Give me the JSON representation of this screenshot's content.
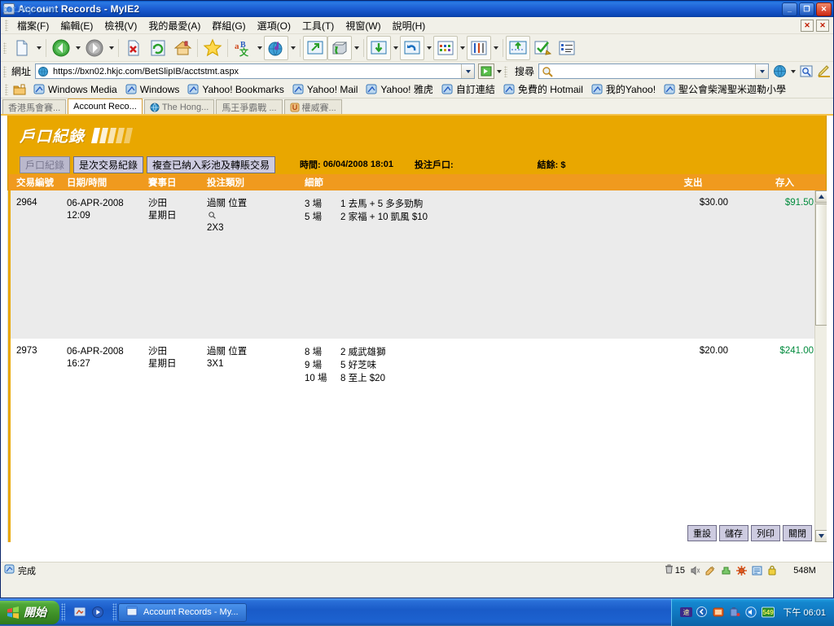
{
  "window": {
    "title": "Account Records - MyIE2",
    "watermark": "bet.hkjc.com",
    "minimize_label": "_",
    "maximize_label": "❐",
    "close_label": "✕"
  },
  "menubar": {
    "items": [
      {
        "label": "檔案(F)",
        "name": "menu-file"
      },
      {
        "label": "編輯(E)",
        "name": "menu-edit"
      },
      {
        "label": "檢視(V)",
        "name": "menu-view"
      },
      {
        "label": "我的最愛(A)",
        "name": "menu-favorites"
      },
      {
        "label": "群組(G)",
        "name": "menu-group"
      },
      {
        "label": "選項(O)",
        "name": "menu-options"
      },
      {
        "label": "工具(T)",
        "name": "menu-tools"
      },
      {
        "label": "視窗(W)",
        "name": "menu-window"
      },
      {
        "label": "說明(H)",
        "name": "menu-help"
      }
    ],
    "doc_close_label": "✕",
    "app_close_label": "✕"
  },
  "toolbar": {
    "icons": [
      "new-page-icon",
      "back-icon",
      "forward-icon",
      "stop-icon",
      "refresh-icon",
      "home-icon",
      "favorites-star-icon",
      "translate-icon",
      "globe-media-icon",
      "open-external-icon",
      "download-manager-icon",
      "save-page-icon",
      "undo-close-icon",
      "grid-view-icon",
      "tools-icon",
      "upload-icon",
      "check-page-icon",
      "list-view-icon"
    ]
  },
  "address": {
    "label": "網址",
    "url": "https://bxn02.hkjc.com/BetSlipIB/acctstmt.aspx",
    "go_label": "▶",
    "search_label": "搜尋",
    "search_value": "",
    "search_placeholder": ""
  },
  "links": {
    "items": [
      {
        "label": "Windows Media"
      },
      {
        "label": "Windows"
      },
      {
        "label": "Yahoo! Bookmarks"
      },
      {
        "label": "Yahoo! Mail"
      },
      {
        "label": "Yahoo! 雅虎"
      },
      {
        "label": "自訂連結"
      },
      {
        "label": "免費的 Hotmail"
      },
      {
        "label": "我的Yahoo!"
      },
      {
        "label": "聖公會柴灣聖米迦勒小學"
      }
    ]
  },
  "tabs": [
    {
      "label": "香港馬會賽...",
      "active": false,
      "icon": false
    },
    {
      "label": "Account Reco...",
      "active": true,
      "icon": false
    },
    {
      "label": "The Hong...",
      "active": false,
      "icon": true
    },
    {
      "label": "馬王爭霸戰 ...",
      "active": false,
      "icon": false
    },
    {
      "label": "權威賽...",
      "active": false,
      "icon": true
    }
  ],
  "banner": {
    "title": "戶口紀錄"
  },
  "subbar": {
    "pills": [
      {
        "label": "戶口紀錄",
        "selected": true
      },
      {
        "label": "是次交易紀錄",
        "selected": false
      },
      {
        "label": "複查已納入彩池及轉賬交易",
        "selected": false
      }
    ],
    "time_label": "時間:",
    "time_value": "06/04/2008 18:01",
    "account_label": "投注戶口:",
    "account_value": "",
    "balance_label": "結餘: $",
    "balance_value": ""
  },
  "table": {
    "columns": [
      {
        "key": "id",
        "label": "交易編號"
      },
      {
        "key": "datetime",
        "label": "日期/時間"
      },
      {
        "key": "raceday",
        "label": "賽事日"
      },
      {
        "key": "bettype",
        "label": "投注類別"
      },
      {
        "key": "detail",
        "label": "細節"
      },
      {
        "key": "out",
        "label": "支出"
      },
      {
        "key": "in",
        "label": "存入"
      }
    ],
    "rows": [
      {
        "id": "2964",
        "date": "06-APR-2008",
        "time": "12:09",
        "venue": "沙田",
        "weekday": "星期日",
        "bettype": "過關 位置",
        "bettype_has_magnifier": true,
        "combo": "2X3",
        "details": [
          {
            "race": "3 場",
            "text": "1 去馬 + 5 多多勁駒"
          },
          {
            "race": "5 場",
            "text": "2 家福 + 10 凱風 $10"
          }
        ],
        "out": "$30.00",
        "in": "$91.50"
      },
      {
        "id": "2973",
        "date": "06-APR-2008",
        "time": "16:27",
        "venue": "沙田",
        "weekday": "星期日",
        "bettype": "過關 位置",
        "bettype_has_magnifier": false,
        "combo": "3X1",
        "details": [
          {
            "race": "8 場",
            "text": "2 威武雄獅"
          },
          {
            "race": "9 場",
            "text": "5 好芝味"
          },
          {
            "race": "10 場",
            "text": "8 至上 $20"
          }
        ],
        "out": "$20.00",
        "in": "$241.00"
      }
    ]
  },
  "page_buttons": [
    {
      "label": "重設"
    },
    {
      "label": "儲存"
    },
    {
      "label": "列印"
    },
    {
      "label": "關閉"
    }
  ],
  "statusbar": {
    "text": "完成",
    "blocked_count": "15",
    "memory": "548M",
    "icons": [
      "trash-icon",
      "mute-icon",
      "ad-filter-icon",
      "plugin-icon",
      "settings-icon",
      "proxy-icon",
      "lock-icon"
    ]
  },
  "taskbar": {
    "start_label": "開始",
    "quicklaunch": [
      "show-desktop-icon",
      "media-player-icon"
    ],
    "buttons": [
      {
        "label": "Account Records - My...",
        "active": true
      }
    ],
    "tray_icons": [
      "network-speed-icon",
      "chevron-left-icon",
      "messenger-icon",
      "usb-icon",
      "volume-icon",
      "battery-icon"
    ],
    "clock": "下午 06:01"
  },
  "colors": {
    "banner_gold": "#e9a700",
    "header_orange": "#f09a1e",
    "credit_green": "#008a3c",
    "title_blue": "#1d5fd4",
    "taskbar_blue": "#1a5bc8",
    "start_green": "#4fa838"
  }
}
